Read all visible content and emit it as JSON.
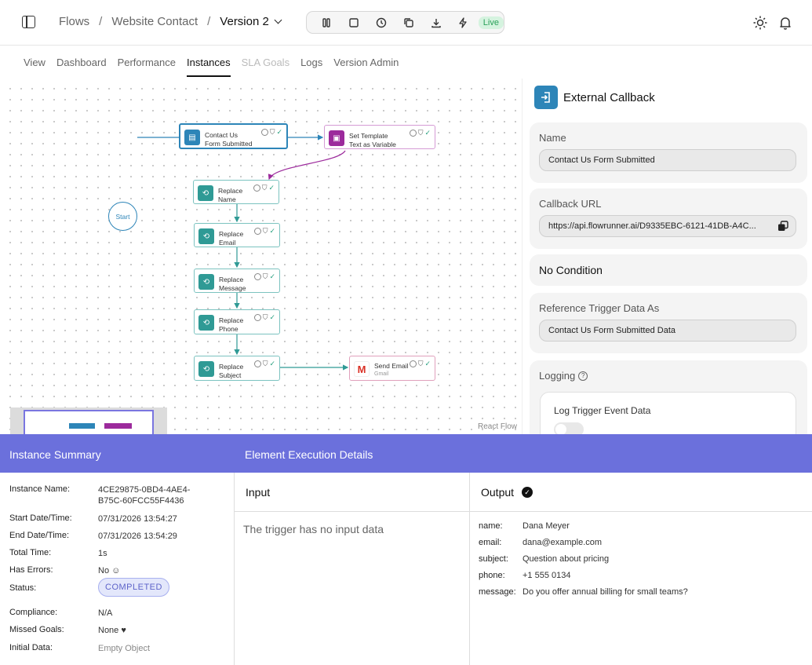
{
  "breadcrumb": {
    "flows": "Flows",
    "website": "Website Contact",
    "version": "Version 2",
    "sep": "/"
  },
  "toolbar": {
    "live": "Live",
    "icons": [
      "pause-icon",
      "stop-icon",
      "history-icon",
      "copy-icon",
      "download-icon",
      "lightning-icon"
    ]
  },
  "tabs": [
    "View",
    "Dashboard",
    "Performance",
    "Instances",
    "SLA Goals",
    "Logs",
    "Version Admin"
  ],
  "active_tab": "Instances",
  "flow": {
    "start": "Start",
    "nodes": [
      {
        "label": "Contact Us Form Submitted"
      },
      {
        "label": "Set Template Text as Variable"
      },
      {
        "label": "Replace Name"
      },
      {
        "label": "Replace Email"
      },
      {
        "label": "Replace Message"
      },
      {
        "label": "Replace Phone"
      },
      {
        "label": "Replace Subject"
      },
      {
        "label": "Send Email",
        "sub": "Gmail"
      }
    ],
    "watermark": "React Flow"
  },
  "panel": {
    "title": "External Callback",
    "name_label": "Name",
    "name_value": "Contact Us Form Submitted",
    "callback_label": "Callback URL",
    "callback_value": "https://api.flowrunner.ai/D9335EBC-6121-41DB-A4C...",
    "condition": "No Condition",
    "ref_label": "Reference Trigger Data As",
    "ref_value": "Contact Us Form Submitted Data",
    "logging_label": "Logging",
    "log_trigger_label": "Log Trigger Event Data"
  },
  "bottom": {
    "instance_summary": "Instance Summary",
    "element_details": "Element Execution Details",
    "summary": [
      {
        "label": "Instance Name:",
        "value": "4CE29875-0BD4-4AE4-B75C-60FCC55F4436"
      },
      {
        "label": "Start Date/Time:",
        "value": "07/31/2026 13:54:27"
      },
      {
        "label": "End Date/Time:",
        "value": "07/31/2026 13:54:29"
      },
      {
        "label": "Total Time:",
        "value": "1s"
      },
      {
        "label": "Has Errors:",
        "value": "No ☺"
      },
      {
        "label": "Status:",
        "value": "COMPLETED"
      },
      {
        "label": "Compliance:",
        "value": "N/A"
      },
      {
        "label": "Missed Goals:",
        "value": "None ♥"
      },
      {
        "label": "Initial Data:",
        "value": "Empty Object"
      }
    ],
    "input_title": "Input",
    "input_text": "The trigger has no input data",
    "output_title": "Output",
    "output": [
      {
        "key": "name:",
        "value": "Dana Meyer"
      },
      {
        "key": "email:",
        "value": "dana@example.com"
      },
      {
        "key": "subject:",
        "value": "Question about pricing"
      },
      {
        "key": "phone:",
        "value": "+1 555 0134"
      },
      {
        "key": "message:",
        "value": "Do you offer annual billing for small teams?"
      }
    ]
  },
  "colors": {
    "accent": "#6b70dc",
    "teal": "#2f9a95",
    "purple": "#9c2a9c",
    "blue": "#2d85b8",
    "live_bg": "#d5f3df",
    "live_fg": "#2aa059"
  }
}
